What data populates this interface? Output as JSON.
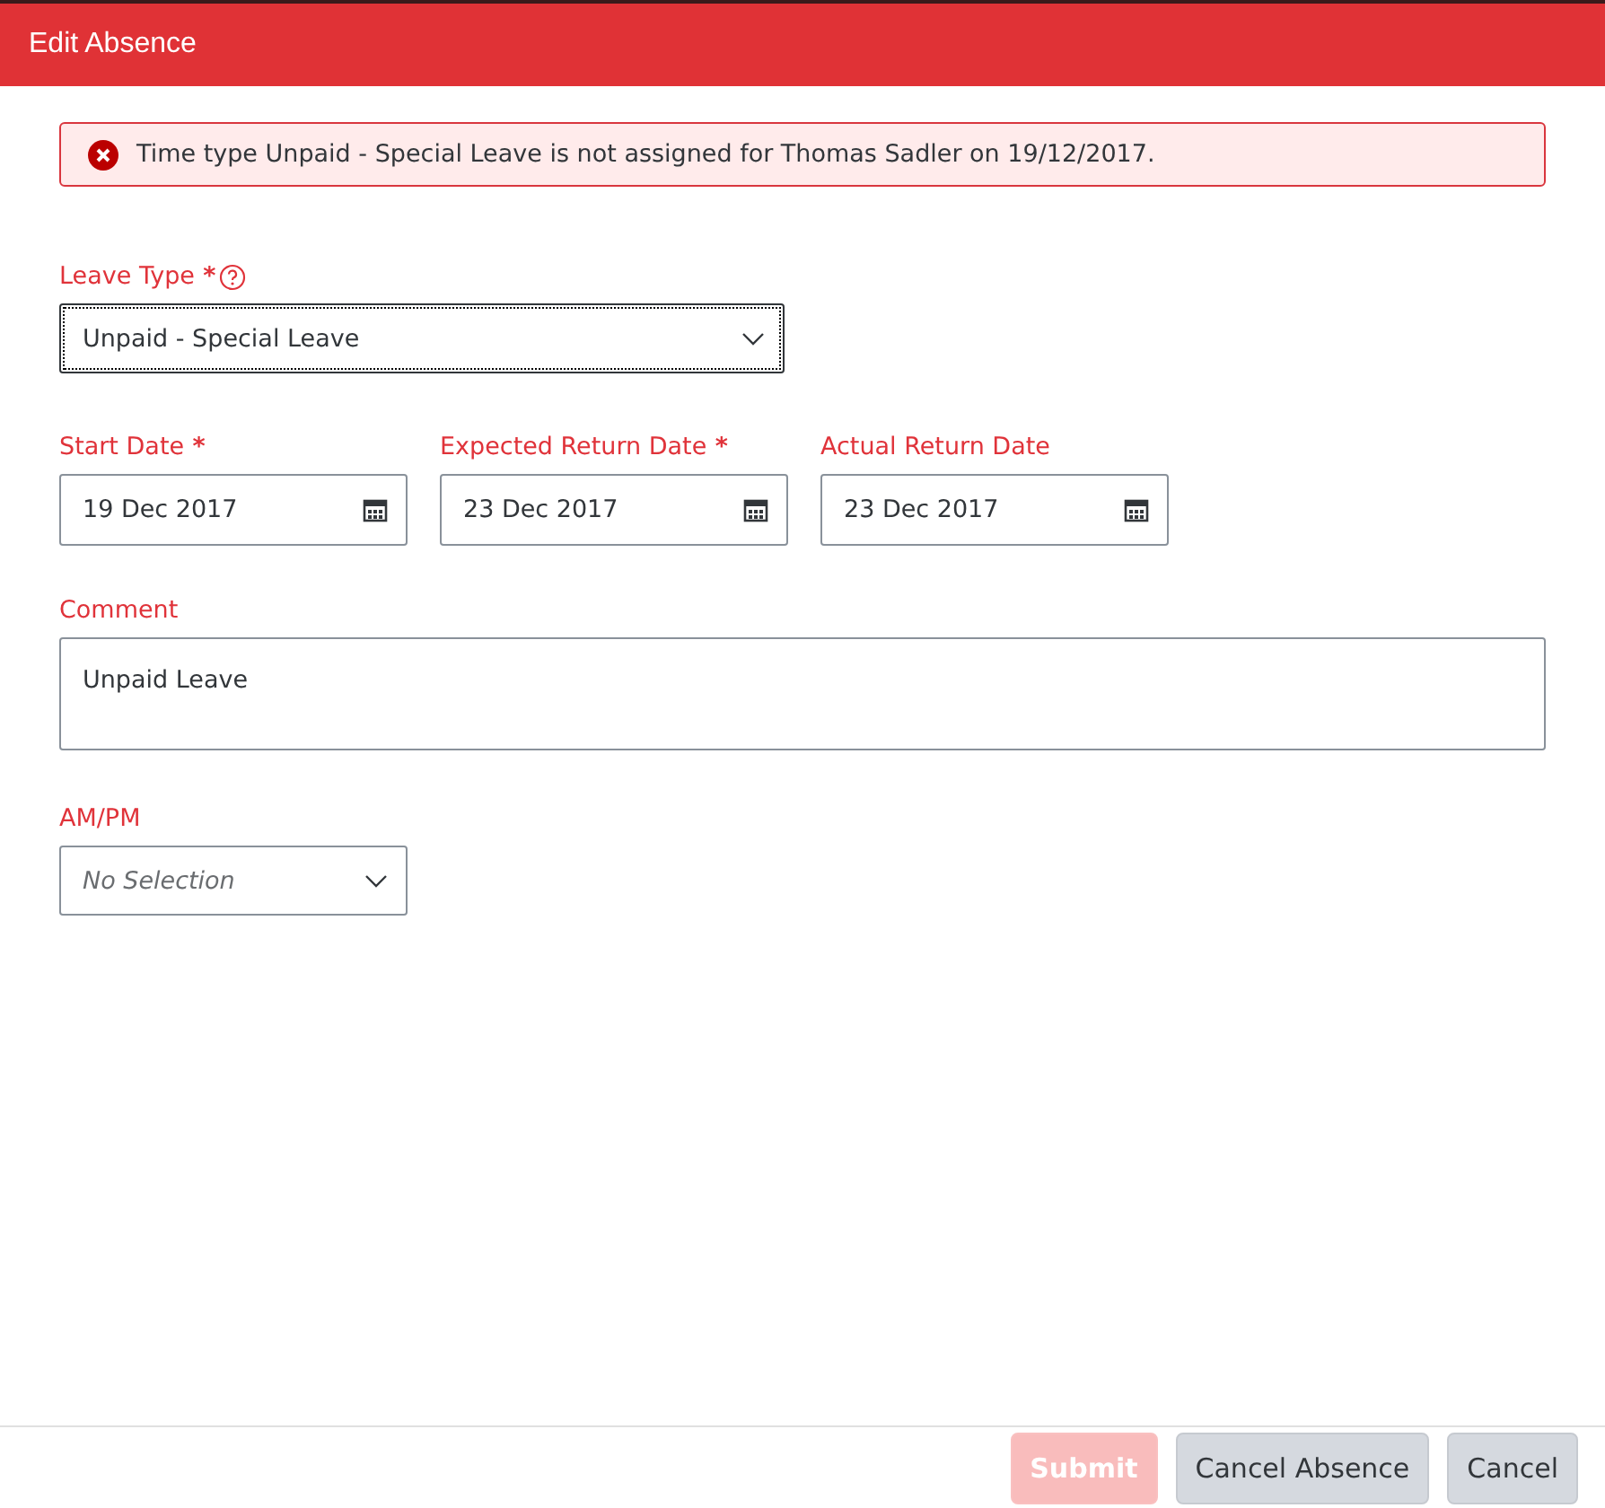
{
  "dialog": {
    "title": "Edit Absence"
  },
  "error": {
    "message": "Time type Unpaid - Special Leave is not assigned for Thomas Sadler on 19/12/2017."
  },
  "leave_type": {
    "label": "Leave Type",
    "required": true,
    "help": true,
    "value": "Unpaid - Special Leave",
    "focused": true
  },
  "dates": [
    {
      "label": "Start Date",
      "required": true,
      "value": "19 Dec 2017"
    },
    {
      "label": "Expected Return Date",
      "required": true,
      "value": "23 Dec 2017"
    },
    {
      "label": "Actual Return Date",
      "required": false,
      "value": "23 Dec 2017"
    }
  ],
  "required_mark": "*",
  "comment": {
    "label": "Comment",
    "value": "Unpaid Leave"
  },
  "am_pm": {
    "label": "AM/PM",
    "placeholder": "No Selection"
  },
  "buttons": [
    {
      "label": "Submit",
      "kind": "primary",
      "disabled": true
    },
    {
      "label": "Cancel Absence",
      "kind": "secondary",
      "disabled": false
    },
    {
      "label": "Cancel",
      "kind": "secondary",
      "disabled": false
    }
  ]
}
